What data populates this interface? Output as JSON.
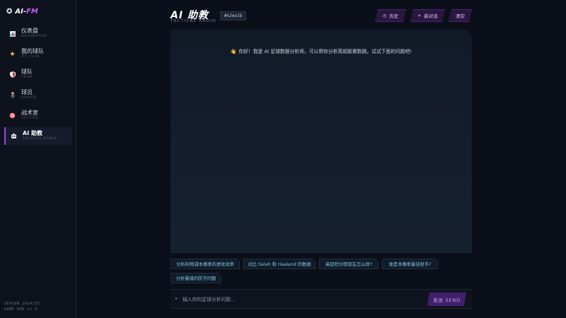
{
  "brand": {
    "name_prefix": "AI-",
    "name_suffix": "FM"
  },
  "sidebar": {
    "items": [
      {
        "cn": "仪表盘",
        "en": "DASHBOARD",
        "icon": "bar-chart-icon"
      },
      {
        "cn": "我的球队",
        "en": "MY CLUB",
        "icon": "star-icon"
      },
      {
        "cn": "球队",
        "en": "TEAM",
        "icon": "shield-icon"
      },
      {
        "cn": "球员",
        "en": "PLAYER",
        "icon": "player-icon"
      },
      {
        "cn": "战术室",
        "en": "TACTICS",
        "icon": "target-icon"
      },
      {
        "cn": "AI 助教",
        "en": "TACTICAL RADIO",
        "icon": "robot-icon",
        "active": true
      }
    ],
    "season": "SEASON 2024/25",
    "version": "GAME HUD v1.0"
  },
  "header": {
    "title": "AI 助教",
    "subtitle": "TACTICAL RADIO",
    "session_tag": "#n2ex1b",
    "history_label": "历史",
    "new_chat_label": "新对话",
    "clear_label": "清空"
  },
  "chat": {
    "welcome": "你好！我是 AI 足球数据分析师，可以帮你分析英超联赛数据。试试下面的问题吧!"
  },
  "suggestions": [
    "分析利物浦本赛季的进攻效率",
    "对比 Salah 和 Haaland 的数据",
    "英超积分榜现在怎么样?",
    "谁是本赛季最佳射手?",
    "分析曼城的防守问题"
  ],
  "input": {
    "placeholder": "输入你的足球分析问题...",
    "send_label": "发送 SEND"
  },
  "colors": {
    "accent": "#9b46e0",
    "chip_text": "#7fc3e6",
    "background": "#0b0f19"
  }
}
